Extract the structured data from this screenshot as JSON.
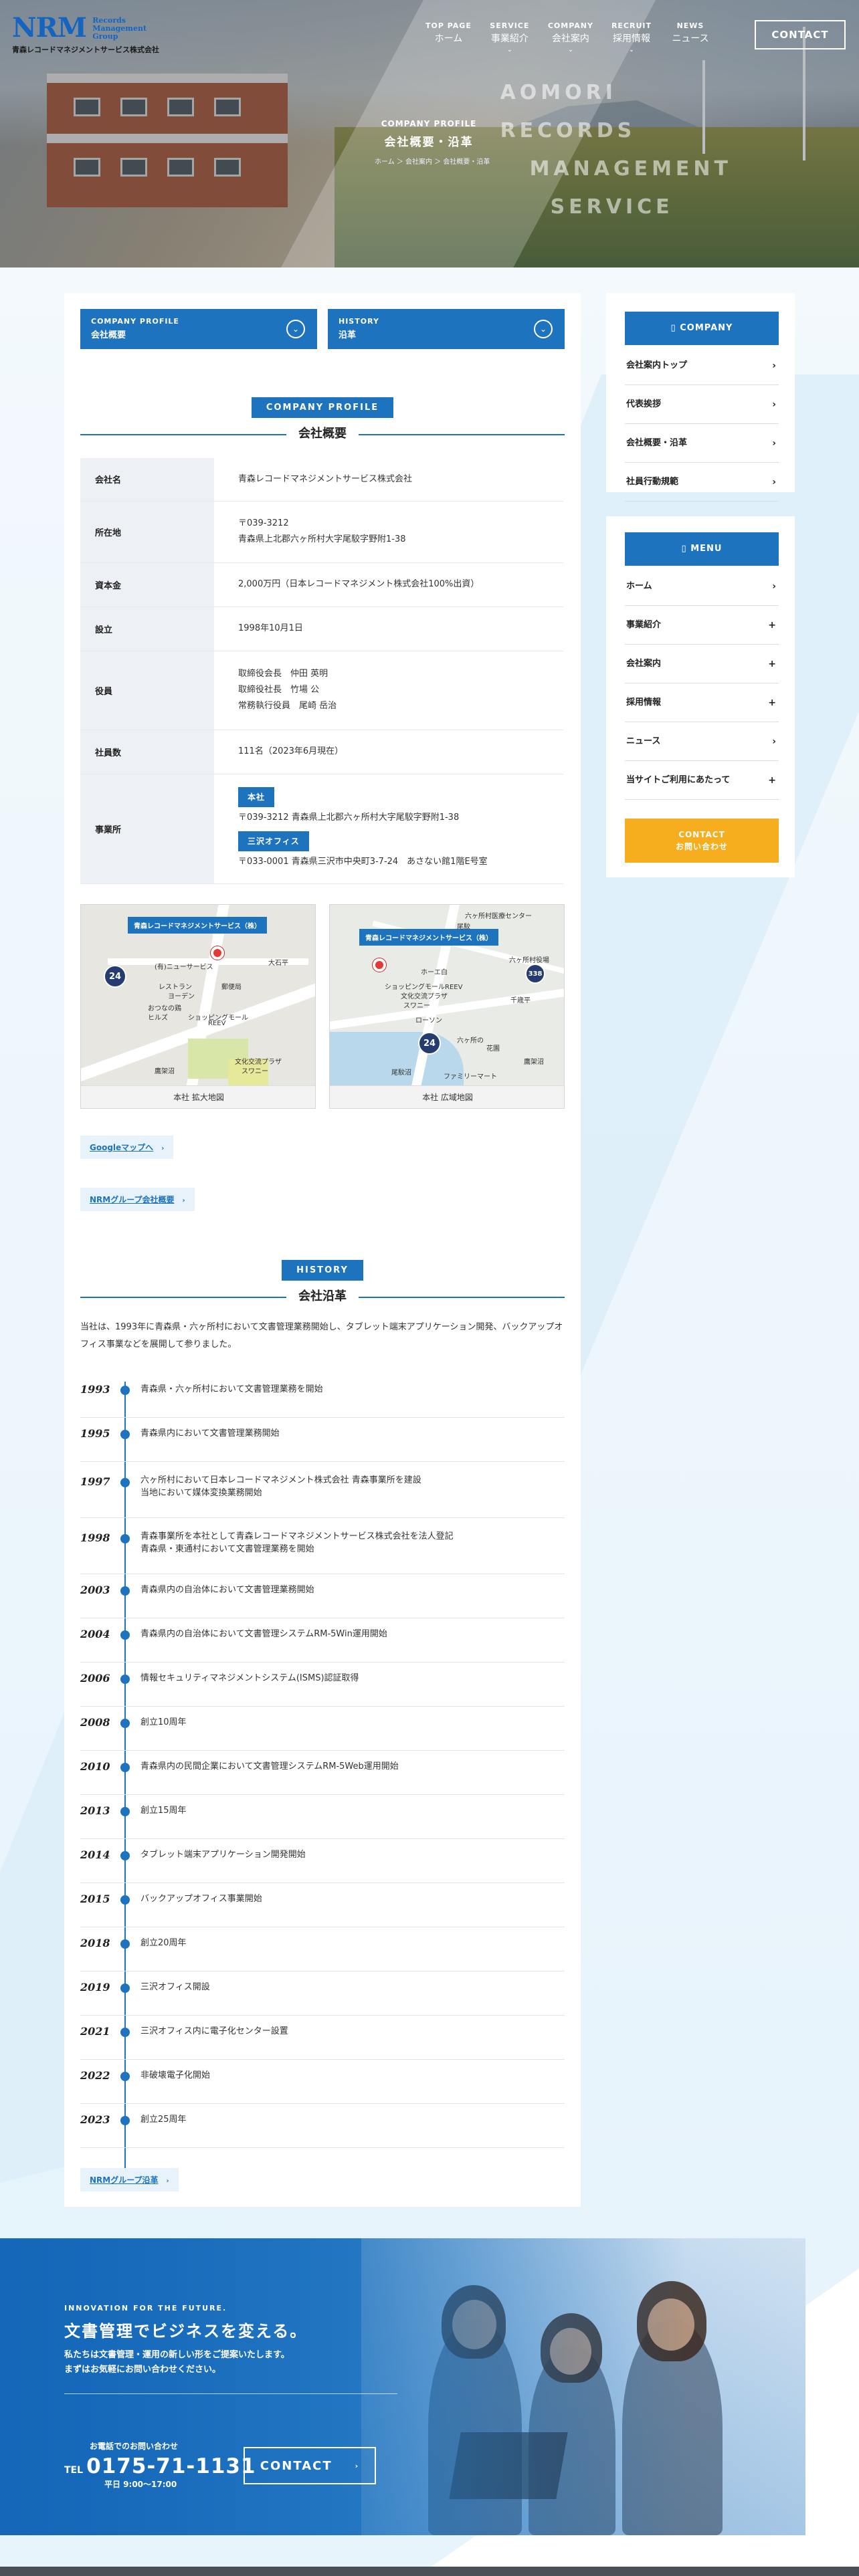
{
  "header": {
    "logo_mark": "NRM",
    "logo_sub": [
      "Records",
      "Management",
      "Group"
    ],
    "company_name": "青森レコードマネジメントサービス株式会社",
    "nav": [
      {
        "en": "TOP PAGE",
        "jp": "ホーム",
        "chevron": ""
      },
      {
        "en": "SERVICE",
        "jp": "事業紹介",
        "chevron": "⌄"
      },
      {
        "en": "COMPANY",
        "jp": "会社案内",
        "chevron": "⌄"
      },
      {
        "en": "RECRUIT",
        "jp": "採用情報",
        "chevron": "⌄"
      },
      {
        "en": "NEWS",
        "jp": "ニュース",
        "chevron": ""
      }
    ],
    "contact": "CONTACT"
  },
  "hero": {
    "watermark": [
      "AOMORI",
      "RECORDS",
      "MANAGEMENT",
      "SERVICE"
    ],
    "title_en": "COMPANY PROFILE",
    "title_jp": "会社概要・沿革",
    "breadcrumb": "ホーム ＞ 会社案内 ＞ 会社概要・沿革"
  },
  "tabs": [
    {
      "en": "COMPANY PROFILE",
      "jp": "会社概要"
    },
    {
      "en": "HISTORY",
      "jp": "沿革"
    }
  ],
  "profile": {
    "badge": "COMPANY PROFILE",
    "title": "会社概要",
    "rows": [
      {
        "key": "会社名",
        "lines": [
          "青森レコードマネジメントサービス株式会社"
        ]
      },
      {
        "key": "所在地",
        "lines": [
          "〒039-3212",
          "青森県上北郡六ヶ所村大字尾駮字野附1-38"
        ]
      },
      {
        "key": "資本金",
        "lines": [
          "2,000万円（日本レコードマネジメント株式会社100%出資）"
        ]
      },
      {
        "key": "設立",
        "lines": [
          "1998年10月1日"
        ]
      },
      {
        "key": "役員",
        "lines": [
          "取締役会長　仲田 英明",
          "取締役社長　竹場 公",
          "常務執行役員　尾崎 岳治"
        ]
      },
      {
        "key": "社員数",
        "lines": [
          "111名（2023年6月現在）"
        ]
      },
      {
        "key": "事業所",
        "offices": [
          {
            "label": "本社",
            "address": "〒039-3212 青森県上北郡六ヶ所村大字尾駮字野附1-38"
          },
          {
            "label": "三沢オフィス",
            "address": "〒033-0001 青森県三沢市中央町3-7-24　あさない館1階E号室"
          }
        ]
      }
    ]
  },
  "maps": [
    {
      "caption": "本社 拡大地図",
      "flag": "青森レコードマネジメントサービス（株）",
      "shield": "24",
      "labels": [
        "(有)ニューサービス",
        "大石平",
        "郵便局",
        "レストラン",
        "ヨーデン",
        "おつなの鶏",
        "ヒルズ",
        "ショッピングモール",
        "REEV",
        "文化交流プラザ",
        "スワニー",
        "鷹架沼"
      ]
    },
    {
      "caption": "本社 広域地図",
      "flag": "青森レコードマネジメントサービス（株）",
      "shield": "24",
      "route": "338",
      "labels": [
        "六ヶ所村医療センター",
        "尾駮",
        "六ヶ所村役場",
        "ホーエ白",
        "ショッピングモールREEV",
        "文化交流プラザ",
        "スワニー",
        "ローソン",
        "尾駮沼",
        "鷹架沼",
        "六ヶ所の",
        "花園",
        "千歳平",
        "ファミリーマート"
      ]
    }
  ],
  "links": {
    "google_map": "Googleマップへ",
    "group_profile": "NRMグループ会社概要",
    "group_history": "NRMグループ沿革",
    "arrow": "›"
  },
  "history": {
    "badge": "HISTORY",
    "title": "会社沿革",
    "intro": "当社は、1993年に青森県・六ヶ所村において文書管理業務開始し、タブレット端末アプリケーション開発、バックアップオフィス事業などを展開して参りました。",
    "items": [
      {
        "year": "1993",
        "lines": [
          "青森県・六ヶ所村において文書管理業務を開始"
        ]
      },
      {
        "year": "1995",
        "lines": [
          "青森県内において文書管理業務開始"
        ]
      },
      {
        "year": "1997",
        "lines": [
          "六ヶ所村において日本レコードマネジメント株式会社 青森事業所を建設",
          "当地において媒体変換業務開始"
        ]
      },
      {
        "year": "1998",
        "lines": [
          "青森事業所を本社として青森レコードマネジメントサービス株式会社を法人登記",
          "青森県・東通村において文書管理業務を開始"
        ]
      },
      {
        "year": "2003",
        "lines": [
          "青森県内の自治体において文書管理業務開始"
        ]
      },
      {
        "year": "2004",
        "lines": [
          "青森県内の自治体において文書管理システムRM-5Win運用開始"
        ]
      },
      {
        "year": "2006",
        "lines": [
          "情報セキュリティマネジメントシステム(ISMS)認証取得"
        ]
      },
      {
        "year": "2008",
        "lines": [
          "創立10周年"
        ]
      },
      {
        "year": "2010",
        "lines": [
          "青森県内の民間企業において文書管理システムRM-5Web運用開始"
        ]
      },
      {
        "year": "2013",
        "lines": [
          "創立15周年"
        ]
      },
      {
        "year": "2014",
        "lines": [
          "タブレット端末アプリケーション開発開始"
        ]
      },
      {
        "year": "2015",
        "lines": [
          "バックアップオフィス事業開始"
        ]
      },
      {
        "year": "2018",
        "lines": [
          "創立20周年"
        ]
      },
      {
        "year": "2019",
        "lines": [
          "三沢オフィス開設"
        ]
      },
      {
        "year": "2021",
        "lines": [
          "三沢オフィス内に電子化センター設置"
        ]
      },
      {
        "year": "2022",
        "lines": [
          "非破壊電子化開始"
        ]
      },
      {
        "year": "2023",
        "lines": [
          "創立25周年"
        ]
      }
    ]
  },
  "sidebar": {
    "company_head": "COMPANY",
    "company_items": [
      {
        "label": "会社案内トップ",
        "mark": "›"
      },
      {
        "label": "代表挨拶",
        "mark": "›"
      },
      {
        "label": "会社概要・沿革",
        "mark": "›"
      },
      {
        "label": "社員行動規範",
        "mark": "›"
      }
    ],
    "menu_head": "MENU",
    "menu_items": [
      {
        "label": "ホーム",
        "mark": "›"
      },
      {
        "label": "事業紹介",
        "mark": "+"
      },
      {
        "label": "会社案内",
        "mark": "+"
      },
      {
        "label": "採用情報",
        "mark": "+"
      },
      {
        "label": "ニュース",
        "mark": "›"
      },
      {
        "label": "当サイトご利用にあたって",
        "mark": "+"
      }
    ],
    "contact_en": "CONTACT",
    "contact_jp": "お問い合わせ"
  },
  "banner": {
    "en": "INNOVATION FOR THE FUTURE.",
    "catch": "文書管理でビジネスを変える。",
    "desc": [
      "私たちは文書管理・運用の新しい形をご提案いたします。",
      "まずはお気軽にお問い合わせください。"
    ],
    "tel_note": "お電話でのお問い合わせ",
    "tel_label": "TEL",
    "tel": "0175-71-1131",
    "hours": "平日 9:00～17:00",
    "contact": "CONTACT",
    "arrow": "›"
  },
  "colors": {
    "accent": "#1e73be",
    "light_bg": "#e3f1fa",
    "contact_orange": "#f6ae1f",
    "table_key_bg": "#edf1f5"
  }
}
